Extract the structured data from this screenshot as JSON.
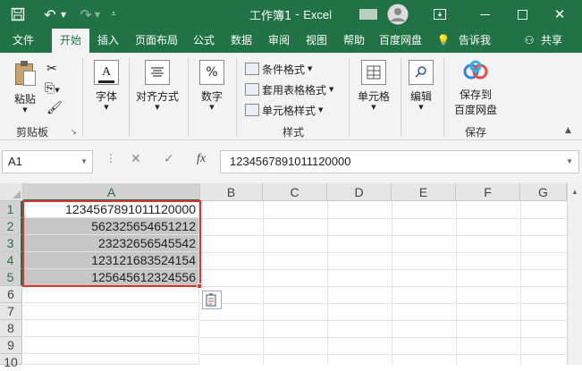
{
  "titlebar": {
    "title": "工作簿1",
    "separator": "-",
    "app": "Excel",
    "save_icon": "save-icon",
    "undo_icon": "undo-icon",
    "redo_icon": "redo-icon"
  },
  "tabs": [
    "文件",
    "开始",
    "插入",
    "页面布局",
    "公式",
    "数据",
    "审阅",
    "视图",
    "帮助",
    "百度网盘",
    "告诉我",
    "共享"
  ],
  "ribbon": {
    "clipboard": {
      "paste": "粘贴",
      "label": "剪贴板"
    },
    "font": {
      "label": "字体"
    },
    "alignment": {
      "label": "对齐方式"
    },
    "number": {
      "label": "数字",
      "symbol": "%"
    },
    "styles": {
      "conditional": "条件格式",
      "table": "套用表格格式",
      "cell": "单元格样式",
      "label": "样式"
    },
    "cells": {
      "label": "单元格"
    },
    "editing": {
      "label": "编辑"
    },
    "save": {
      "line1": "保存到",
      "line2": "百度网盘",
      "label": "保存"
    }
  },
  "formula_bar": {
    "name_box": "A1",
    "fx": "fx",
    "value": "1234567891011120000"
  },
  "grid": {
    "columns": [
      "A",
      "B",
      "C",
      "D",
      "E",
      "F",
      "G"
    ],
    "rows": [
      "1",
      "2",
      "3",
      "4",
      "5",
      "6",
      "7",
      "8",
      "9",
      "10"
    ],
    "cells_A": [
      "1234567891011120000",
      "562325654651212",
      "23232656545542",
      "123121683524154",
      "125645612324556"
    ]
  },
  "colors": {
    "accent": "#217346",
    "selection_border": "#e03030",
    "selection_fill": "#c6c6c6"
  }
}
